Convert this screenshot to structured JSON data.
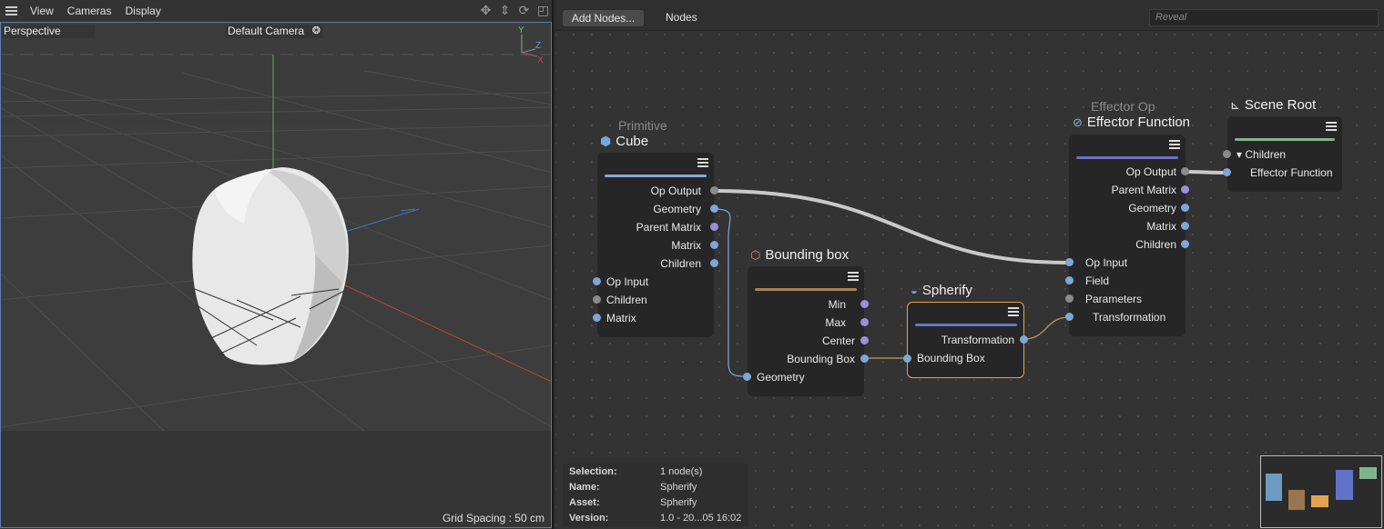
{
  "viewport": {
    "menu": [
      "View",
      "Cameras",
      "Display"
    ],
    "projection": "Perspective",
    "camera": "Default Camera",
    "grid_spacing": "Grid Spacing : 50 cm",
    "axes": {
      "y": "Y",
      "z": "Z",
      "x": "X"
    }
  },
  "editor": {
    "add_nodes": "Add Nodes...",
    "tab": "Nodes",
    "reveal_placeholder": "Reveal",
    "nodes": {
      "cube": {
        "category": "Primitive",
        "title": "Cube",
        "outputs": [
          "Op Output",
          "Geometry",
          "Parent Matrix",
          "Matrix",
          "Children"
        ],
        "inputs": [
          "Op Input",
          "Children",
          "Matrix"
        ],
        "bar_color": "#86a9d4"
      },
      "bounding_box": {
        "title": "Bounding box",
        "outputs": [
          "Min",
          "Max",
          "Center",
          "Bounding Box"
        ],
        "inputs": [
          "Geometry"
        ],
        "bar_color": "#a9835a"
      },
      "spherify": {
        "title": "Spherify",
        "outputs": [
          "Transformation"
        ],
        "inputs": [
          "Bounding Box"
        ],
        "bar_color": "#6b72c9",
        "selected_color": "#e7a24a"
      },
      "effector": {
        "category": "Effector Op",
        "title": "Effector Function",
        "outputs": [
          "Op Output",
          "Parent Matrix",
          "Geometry",
          "Matrix",
          "Children"
        ],
        "inputs": [
          "Op Input",
          "Field",
          "Parameters",
          "Transformation"
        ],
        "bar_color": "#6b72c9"
      },
      "scene_root": {
        "title": "Scene Root",
        "inputs": [
          "Children",
          "Effector Function"
        ],
        "bar_color": "#7fb58a"
      }
    },
    "selection_info": [
      {
        "key": "Selection:",
        "value": "1 node(s)"
      },
      {
        "key": "Name:",
        "value": "Spherify"
      },
      {
        "key": "Asset:",
        "value": "Spherify"
      },
      {
        "key": "Version:",
        "value": "1.0 - 20...05 16:02"
      }
    ],
    "minimap_colors": [
      "#6c9bc4",
      "#9a7550",
      "#e3a44b",
      "#6273c8",
      "#7fb58a"
    ]
  }
}
